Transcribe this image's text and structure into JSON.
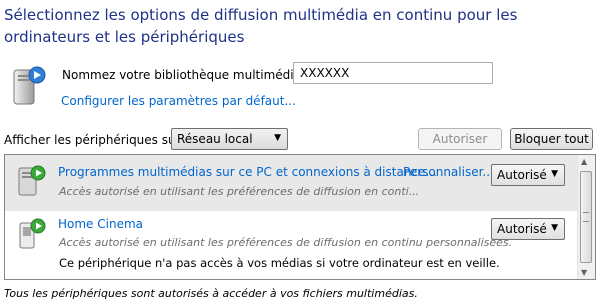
{
  "title": "Sélectionnez les options de diffusion multimédia en continu pour les ordinateurs et les périphériques",
  "library": {
    "label": "Nommez votre bibliothèque multimédia :",
    "value": "XXXXXX",
    "defaults_link": "Configurer les paramètres par défaut..."
  },
  "filter": {
    "label": "Afficher les périphériques sur :",
    "selected": "Réseau local",
    "allow_all": "Autoriser tout",
    "block_all": "Bloquer tout"
  },
  "devices": [
    {
      "name": "Programmes multimédias sur ce PC et connexions à distance...",
      "customize": "Personnaliser...",
      "description": "Accès autorisé en utilisant les préférences de diffusion en conti...",
      "status": "Autorisé",
      "icon": "media-player-pc-icon"
    },
    {
      "name": "Home Cinema",
      "description": "Accès autorisé en utilisant les préférences de diffusion en continu personnalisées.",
      "warning": "Ce périphérique n'a pas accès à vos médias si votre ordinateur est en veille.",
      "status": "Autorisé",
      "icon": "home-cinema-device-icon"
    }
  ],
  "footer": "Tous les périphériques sont autorisés à accéder à vos fichiers multimédias.",
  "colors": {
    "title": "#1e3287",
    "link": "#0066cc",
    "selected_row": "#e8e8e8"
  }
}
